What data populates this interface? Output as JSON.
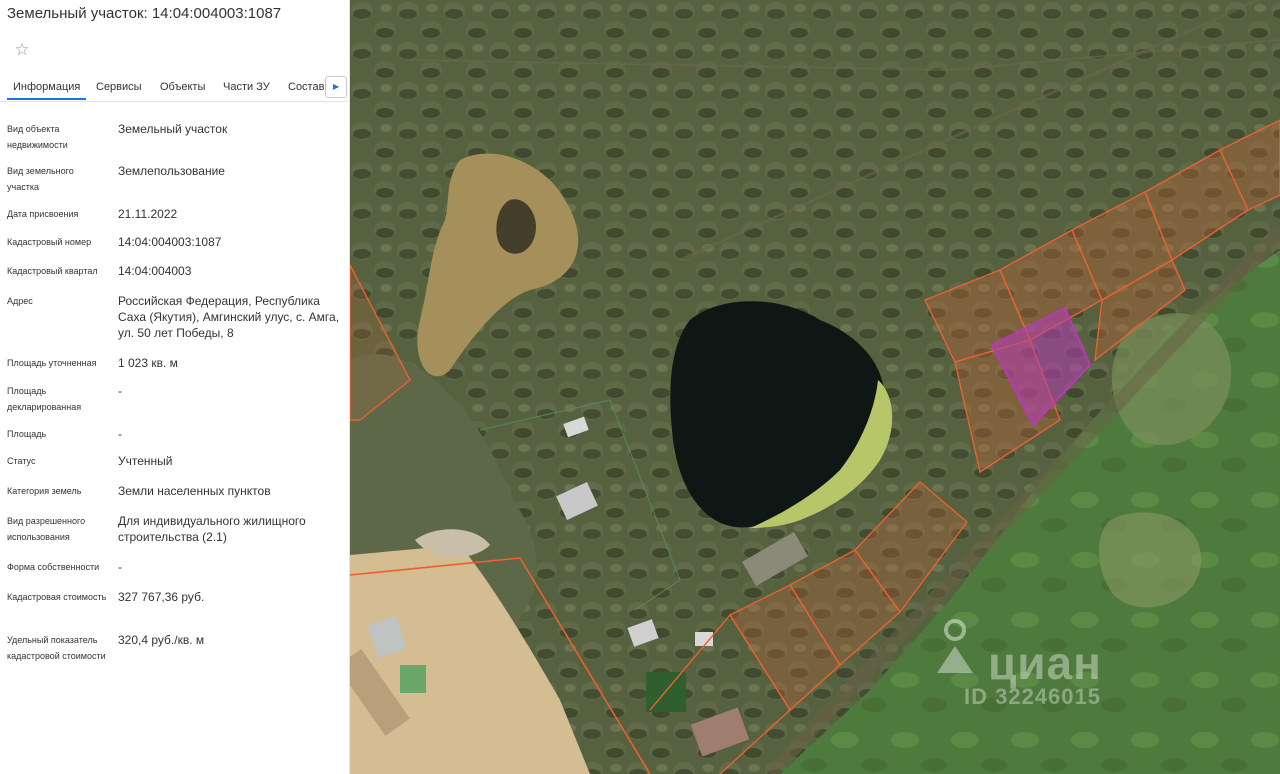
{
  "panel": {
    "title": "Земельный участок: 14:04:004003:1087",
    "tabs": [
      "Информация",
      "Сервисы",
      "Объекты",
      "Части ЗУ",
      "Состав"
    ],
    "next_tab_icon": "triangle-right-icon",
    "fields": [
      {
        "label": "Вид объекта недвижимости",
        "value": "Земельный участок"
      },
      {
        "label": "Вид земельного участка",
        "value": "Землепользование"
      },
      {
        "label": "Дата присвоения",
        "value": "21.11.2022"
      },
      {
        "label": "Кадастровый номер",
        "value": "14:04:004003:1087"
      },
      {
        "label": "Кадастровый квартал",
        "value": "14:04:004003"
      },
      {
        "label": "Адрес",
        "value": "Российская Федерация, Республика Саха (Якутия), Амгинский улус, с. Амга, ул. 50 лет Победы, 8"
      },
      {
        "label": "Площадь уточненная",
        "value": "1 023 кв. м"
      },
      {
        "label": "Площадь декларированная",
        "value": "-"
      },
      {
        "label": "Площадь",
        "value": "-"
      },
      {
        "label": "Статус",
        "value": "Учтенный"
      },
      {
        "label": "Категория земель",
        "value": "Земли населенных пунктов"
      },
      {
        "label": "Вид разрешенного использования",
        "value": "Для индивидуального жилищного строительства (2.1)"
      },
      {
        "label": "Форма собственности",
        "value": "-"
      },
      {
        "label": "Кадастровая стоимость",
        "value": "327 767,36 руб."
      },
      {
        "label": "Удельный показатель кадастровой стоимости",
        "value": "320,4 руб./кв. м"
      }
    ]
  },
  "map": {
    "watermark_brand": "циан",
    "watermark_id": "ID 32246015",
    "colors": {
      "parcel_border": "#e8622e",
      "selected_parcel": "#b63ab6",
      "pond_water": "#0f1714",
      "algae": "#b8c66a"
    }
  }
}
